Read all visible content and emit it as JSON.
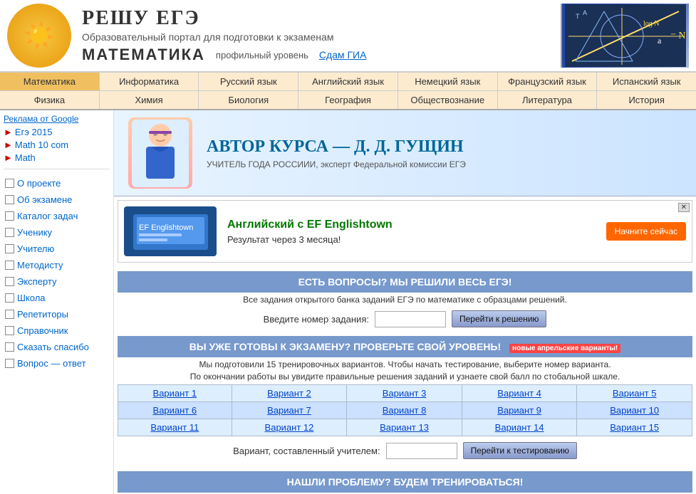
{
  "header": {
    "title": "РЕШУ ЕГЭ",
    "subtitle": "Образовательный портал для подготовки к экзаменам",
    "math_title": "МАТЕМАТИКА",
    "math_level": "профильный уровень",
    "gia_link": "Сдам ГИА"
  },
  "nav_top": [
    "Математика",
    "Информатика",
    "Русский язык",
    "Английский язык",
    "Немецкий язык",
    "Французский язык",
    "Испанский язык"
  ],
  "nav_bottom": [
    "Физика",
    "Химия",
    "Биология",
    "География",
    "Обществознание",
    "Литература",
    "История"
  ],
  "sidebar": {
    "ads_label": "Реклама от Google",
    "ad_items": [
      {
        "label": "Егэ 2015"
      },
      {
        "label": "Math 10 com"
      },
      {
        "label": "Math"
      }
    ],
    "menu_items": [
      "О проекте",
      "Об экзамене",
      "Каталог задач",
      "Ученику",
      "Учителю",
      "Методисту",
      "Эксперту",
      "Школа",
      "Репетиторы",
      "Справочник",
      "Сказать спасибо",
      "Вопрос — ответ"
    ]
  },
  "author": {
    "title": "АВТОР КУРСА — Д. Д. ГУЩИН",
    "subtitle": "УЧИТЕЛЬ ГОДА РОССИИИ, эксперт Федеральной комиссии ЕГЭ"
  },
  "ef_banner": {
    "title": "Английский с EF Englishtown",
    "subtitle": "Результат через 3 месяца!",
    "button": "Начните сейчас"
  },
  "section1": {
    "header": "ЕСТЬ ВОПРОСЫ? МЫ РЕШИЛИ ВЕСЬ ЕГЭ!",
    "sub": "Все задания открытого банка заданий ЕГЭ по математике с образцами решений.",
    "label": "Введите номер задания:",
    "button": "Перейти к решению"
  },
  "section2": {
    "header": "ВЫ УЖЕ ГОТОВЫ К ЭКЗАМЕНУ? ПРОВЕРЬТЕ СВОЙ УРОВЕНЬ!",
    "new_badge": "новые апрельские варианты!",
    "sub1": "Мы подготовили 15 тренировочных вариантов. Чтобы начать тестирование, выберите номер варианта.",
    "sub2": "По окончании работы вы увидите правильные решения заданий и узнаете свой балл по стобальной шкале.",
    "variants": [
      [
        "Вариант 1",
        "Вариант 2",
        "Вариант 3",
        "Вариант 4",
        "Вариант 5"
      ],
      [
        "Вариант 6",
        "Вариант 7",
        "Вариант 8",
        "Вариант 9",
        "Вариант 10"
      ],
      [
        "Вариант 11",
        "Вариант 12",
        "Вариант 13",
        "Вариант 14",
        "Вариант 15"
      ]
    ],
    "teacher_label": "Вариант, составленный учителем:",
    "teacher_button": "Перейти к тестированию"
  },
  "section3": {
    "header": "НАШЛИ ПРОБЛЕМУ? БУДЕМ ТРЕНИРОВАТЬСЯ!"
  }
}
